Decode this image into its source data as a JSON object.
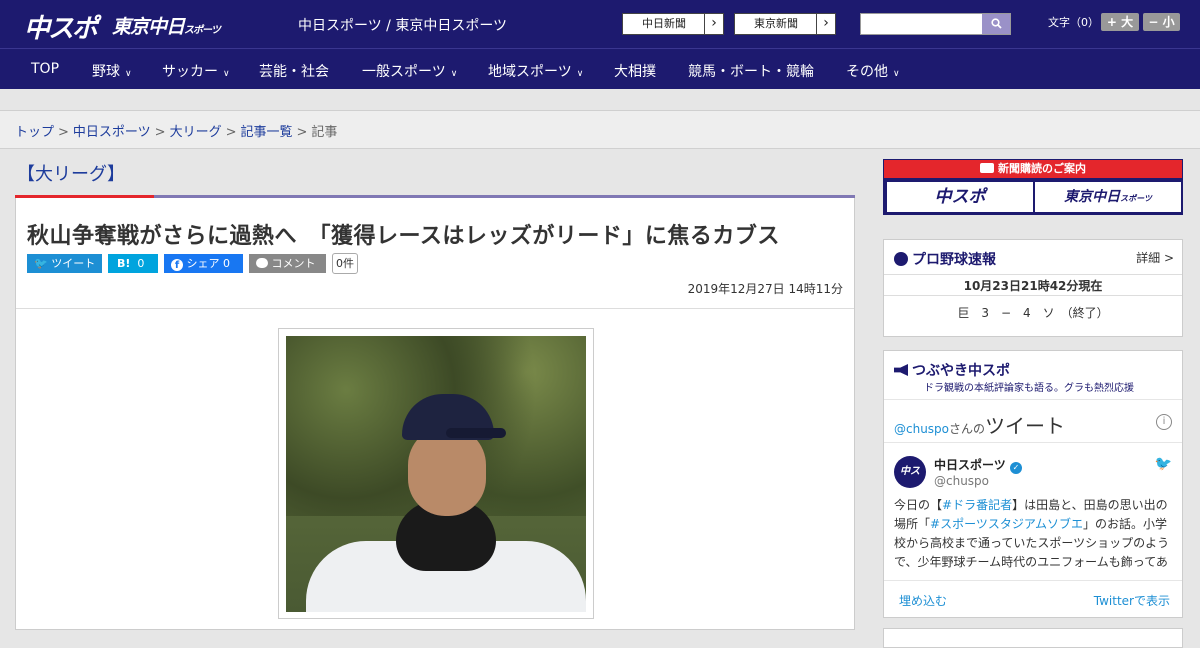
{
  "header": {
    "logo_main": "中スポ",
    "logo_sub": "東京中日",
    "logo_sub_small": "スポーツ",
    "site_name": "中日スポーツ / 東京中日スポーツ",
    "paper_links": [
      "中日新聞",
      "東京新聞"
    ],
    "font_label": "文字（0）",
    "font_bigger": "+ 大",
    "font_smaller": "− 小"
  },
  "nav": {
    "items": [
      {
        "label": "TOP",
        "dropdown": false
      },
      {
        "label": "野球",
        "dropdown": true
      },
      {
        "label": "サッカー",
        "dropdown": true
      },
      {
        "label": "芸能・社会",
        "dropdown": false
      },
      {
        "label": "一般スポーツ",
        "dropdown": true
      },
      {
        "label": "地域スポーツ",
        "dropdown": true
      },
      {
        "label": "大相撲",
        "dropdown": false
      },
      {
        "label": "競馬・ボート・競輪",
        "dropdown": false
      },
      {
        "label": "その他",
        "dropdown": true
      }
    ]
  },
  "breadcrumb": [
    "トップ",
    "中日スポーツ",
    "大リーグ",
    "記事一覧",
    "記事"
  ],
  "article": {
    "category": "【大リーグ】",
    "title": "秋山争奪戦がさらに過熱へ　「獲得レースはレッズがリード」に焦るカブス",
    "share": {
      "tweet": "ツイート",
      "hatena_label": "B!",
      "hatena_count": "0",
      "facebook": "シェア",
      "facebook_count": "0",
      "comment": "コメント",
      "comment_count": "0件"
    },
    "date": "2019年12月27日 14時11分"
  },
  "sidebar": {
    "subscription": {
      "header": "新聞購読のご案内",
      "logo_a": "中スポ",
      "logo_b": "東京中日",
      "logo_b_small": "スポーツ"
    },
    "baseball": {
      "title": "プロ野球速報",
      "detail": "詳細 >",
      "as_of": "10月23日21時42分現在",
      "score": "巨　3　−　4　ソ　（終了）"
    },
    "tweets": {
      "title": "つぶやき中スポ",
      "subtitle": "ドラ観戦の本紙評論家も語る。グラも熱烈応援",
      "handle_prefix": "@chuspo",
      "handle_suffix": "さんの",
      "tweets_word": "ツイート",
      "user_name": "中日スポーツ",
      "user_handle": "@chuspo",
      "body_1": "今日の【",
      "tag_1": "#ドラ番記者",
      "body_2": "】は田島と、田島の思い出の場所「",
      "tag_2": "#スポーツスタジアムソブエ",
      "body_3": "」のお話。小学校から高校まで通っていたスポーツショップのようで、少年野球チーム時代のユニフォームも飾ってあ",
      "embed": "埋め込む",
      "view_on": "Twitterで表示"
    }
  },
  "colors": {
    "navy": "#1d1a6f",
    "red": "#e4262c",
    "twitter": "#1d8fd4",
    "facebook": "#1877f2",
    "hatena": "#00a4de"
  }
}
